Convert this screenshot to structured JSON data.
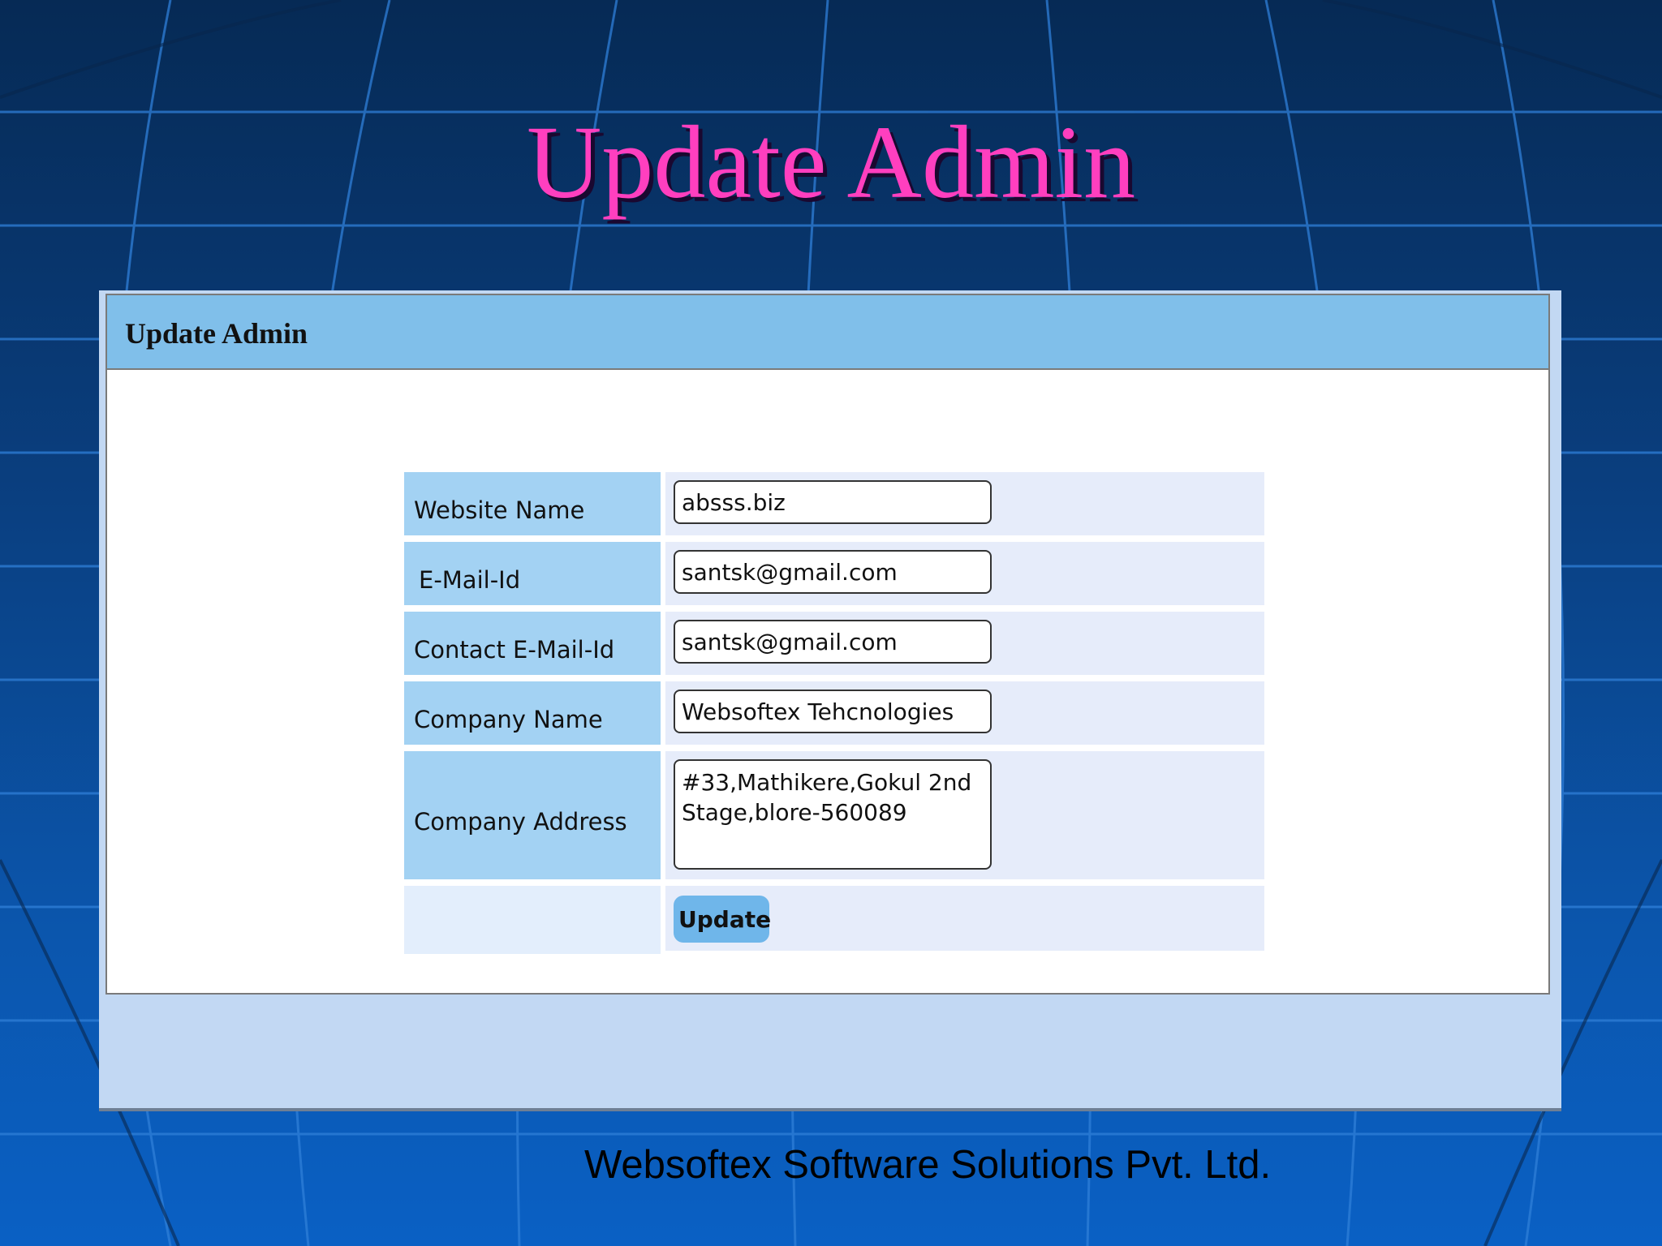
{
  "slide": {
    "title": "Update Admin",
    "footer": "Websoftex Software Solutions Pvt. Ltd."
  },
  "panel": {
    "header": "Update Admin"
  },
  "form": {
    "fields": [
      {
        "label": "Website Name",
        "value": "absss.biz"
      },
      {
        "label": "E-Mail-Id",
        "value": "santsk@gmail.com"
      },
      {
        "label": "Contact E-Mail-Id",
        "value": "santsk@gmail.com"
      },
      {
        "label": "Company Name",
        "value": "Websoftex Tehcnologies"
      },
      {
        "label": "Company Address",
        "value": "#33,Mathikere,Gokul 2nd Stage,blore-560089"
      }
    ],
    "submit_label": "Update"
  },
  "colors": {
    "title": "#ff3fbf",
    "header_bar": "#80bfea",
    "label_cell": "#a3d2f3",
    "input_cell": "#e6ecfa",
    "button": "#6fb6ea"
  }
}
